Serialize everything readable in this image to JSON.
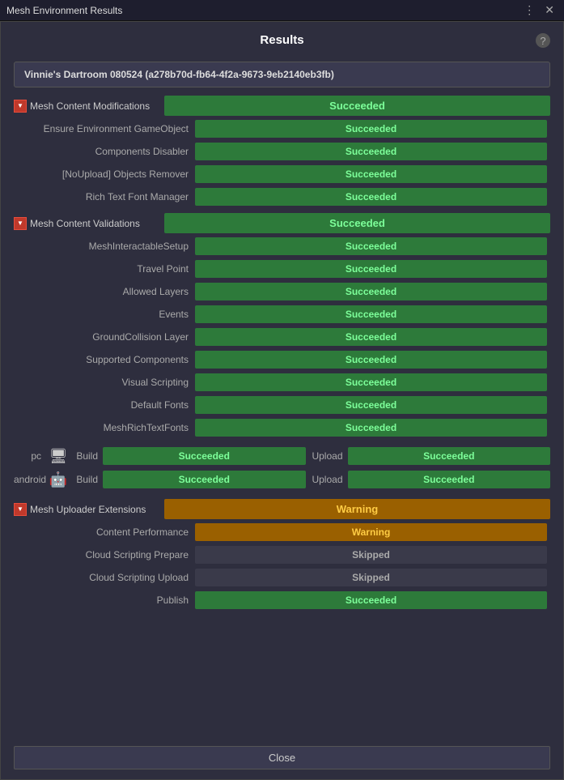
{
  "titleBar": {
    "title": "Mesh Environment Results",
    "controls": [
      "⋮",
      "×"
    ]
  },
  "header": {
    "title": "Results",
    "help": "?"
  },
  "room": {
    "name": "Vinnie's Dartroom 080524 (a278b70d-fb64-4f2a-9673-9eb2140eb3fb)"
  },
  "sections": [
    {
      "id": "mesh-content-modifications",
      "label": "Mesh Content Modifications",
      "status": "Succeeded",
      "statusType": "green",
      "items": [
        {
          "label": "Ensure Environment GameObject",
          "status": "Succeeded",
          "statusType": "succeeded"
        },
        {
          "label": "Components Disabler",
          "status": "Succeeded",
          "statusType": "succeeded"
        },
        {
          "label": "[NoUpload] Objects Remover",
          "status": "Succeeded",
          "statusType": "succeeded"
        },
        {
          "label": "Rich Text Font Manager",
          "status": "Succeeded",
          "statusType": "succeeded"
        }
      ]
    },
    {
      "id": "mesh-content-validations",
      "label": "Mesh Content Validations",
      "status": "Succeeded",
      "statusType": "green",
      "items": [
        {
          "label": "MeshInteractableSetup",
          "status": "Succeeded",
          "statusType": "succeeded"
        },
        {
          "label": "Travel Point",
          "status": "Succeeded",
          "statusType": "succeeded"
        },
        {
          "label": "Allowed Layers",
          "status": "Succeeded",
          "statusType": "succeeded"
        },
        {
          "label": "Events",
          "status": "Succeeded",
          "statusType": "succeeded"
        },
        {
          "label": "GroundCollision Layer",
          "status": "Succeeded",
          "statusType": "succeeded"
        },
        {
          "label": "Supported Components",
          "status": "Succeeded",
          "statusType": "succeeded"
        },
        {
          "label": "Visual Scripting",
          "status": "Succeeded",
          "statusType": "succeeded"
        },
        {
          "label": "Default Fonts",
          "status": "Succeeded",
          "statusType": "succeeded"
        },
        {
          "label": "MeshRichTextFonts",
          "status": "Succeeded",
          "statusType": "succeeded"
        }
      ],
      "platforms": [
        {
          "id": "pc",
          "label": "pc",
          "icon": "🖥",
          "buildLabel": "Build",
          "buildStatus": "Succeeded",
          "buildStatusType": "succeeded",
          "uploadLabel": "Upload",
          "uploadStatus": "Succeeded",
          "uploadStatusType": "succeeded"
        },
        {
          "id": "android",
          "label": "android",
          "icon": "🤖",
          "buildLabel": "Build",
          "buildStatus": "Succeeded",
          "buildStatusType": "succeeded",
          "uploadLabel": "Upload",
          "uploadStatus": "Succeeded",
          "uploadStatusType": "succeeded"
        }
      ]
    },
    {
      "id": "mesh-uploader-extensions",
      "label": "Mesh Uploader Extensions",
      "status": "Warning",
      "statusType": "warning",
      "items": [
        {
          "label": "Content Performance",
          "status": "Warning",
          "statusType": "warning"
        },
        {
          "label": "Cloud Scripting Prepare",
          "status": "Skipped",
          "statusType": "skipped"
        },
        {
          "label": "Cloud Scripting Upload",
          "status": "Skipped",
          "statusType": "skipped"
        },
        {
          "label": "Publish",
          "status": "Succeeded",
          "statusType": "succeeded"
        }
      ]
    }
  ],
  "footer": {
    "closeLabel": "Close"
  }
}
